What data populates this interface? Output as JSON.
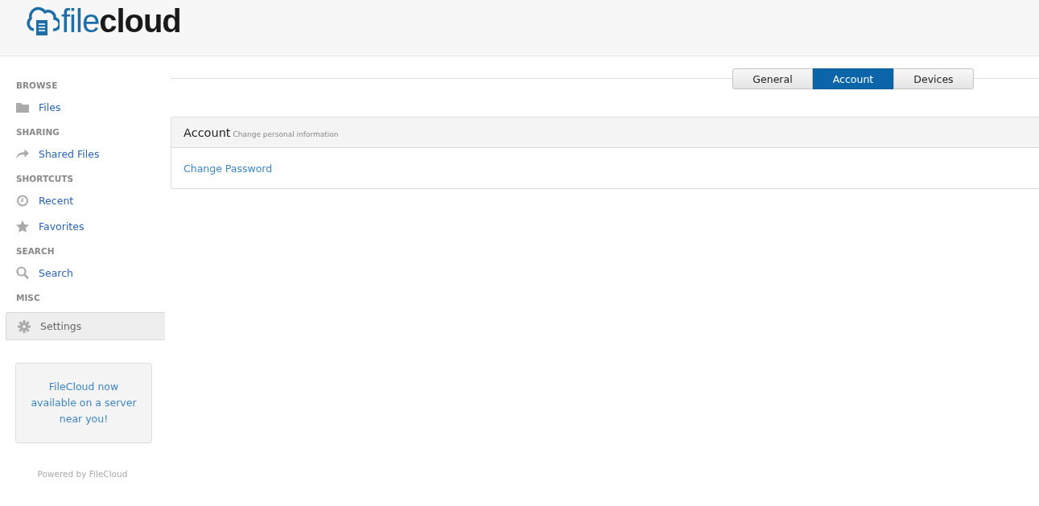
{
  "logo": "file**cloud**",
  "sidebar": [
    {
      "heading": "BROWSE",
      "items": [
        {
          "label": "Files",
          "kind": "folder",
          "selected": false
        }
      ]
    },
    {
      "heading": "SHARING",
      "items": [
        {
          "label": "Shared Files",
          "kind": "share",
          "selected": false
        }
      ]
    },
    {
      "heading": "SHORTCUTS",
      "items": [
        {
          "label": "Recent",
          "kind": "clock",
          "selected": false
        },
        {
          "label": "Favorites",
          "kind": "star",
          "selected": false
        }
      ]
    },
    {
      "heading": "SEARCH",
      "items": [
        {
          "label": "Search",
          "kind": "search",
          "selected": false
        }
      ]
    },
    {
      "heading": "MISC",
      "items": [
        {
          "label": "Settings",
          "kind": "gear",
          "selected": true
        }
      ]
    }
  ],
  "promo": "FileCloud now available on a server near you!",
  "powered_by": "Powered by FileCloud",
  "tabs": [
    {
      "label": "General",
      "selected": false
    },
    {
      "label": "Account",
      "selected": true
    },
    {
      "label": "Devices",
      "selected": false
    }
  ],
  "panel": {
    "title": "Account",
    "subtitle": "Change personal information",
    "links": [
      "Change Password"
    ]
  }
}
